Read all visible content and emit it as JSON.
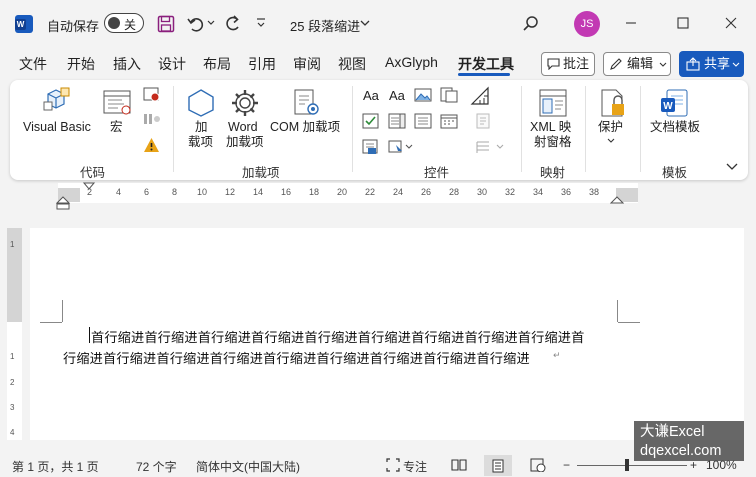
{
  "titlebar": {
    "autosave_label": "自动保存",
    "autosave_state": "关",
    "doc_title": "25 段落缩进",
    "user_initials": "JS"
  },
  "tabs": [
    "文件",
    "开始",
    "插入",
    "设计",
    "布局",
    "引用",
    "审阅",
    "视图",
    "AxGlyph",
    "开发工具"
  ],
  "tab_buttons": {
    "comments": "批注",
    "editing": "编辑",
    "share": "共享"
  },
  "ribbon": {
    "code": {
      "group": "代码",
      "visual_basic": "Visual Basic",
      "macros": "宏"
    },
    "addins": {
      "group": "加载项",
      "addins_line1": "加",
      "addins_line2": "载项",
      "word_line1": "Word",
      "word_line2": "加载项",
      "com": "COM 加载项"
    },
    "controls": {
      "group": "控件",
      "aa1": "Aa",
      "aa2": "Aa"
    },
    "mapping": {
      "group": "映射",
      "xml_line1": "XML 映",
      "xml_line2": "射窗格"
    },
    "protect": {
      "group": "",
      "protect": "保护"
    },
    "templates": {
      "group": "模板",
      "doc_template": "文档模板"
    }
  },
  "ruler": {
    "ticks": [
      "2",
      "4",
      "6",
      "8",
      "10",
      "12",
      "14",
      "16",
      "18",
      "20",
      "22",
      "24",
      "26",
      "28",
      "30",
      "32",
      "34",
      "36",
      "38"
    ],
    "vticks": [
      "1",
      "1",
      "2",
      "3",
      "4"
    ]
  },
  "document": {
    "line1": "首行缩进首行缩进首行缩进首行缩进首行缩进首行缩进首行缩进首行缩进首行缩进首",
    "line2": "行缩进首行缩进首行缩进首行缩进首行缩进首行缩进首行缩进首行缩进首行缩进"
  },
  "statusbar": {
    "page": "第 1 页，共 1 页",
    "words": "72 个字",
    "language": "简体中文(中国大陆)",
    "focus": "专注",
    "zoom": "100%"
  },
  "watermark": {
    "line1": "大谦Excel",
    "line2": "dqexcel.com"
  },
  "colors": {
    "accent": "#185abd",
    "avatar": "#c239b3",
    "warning": "#e8a317"
  }
}
